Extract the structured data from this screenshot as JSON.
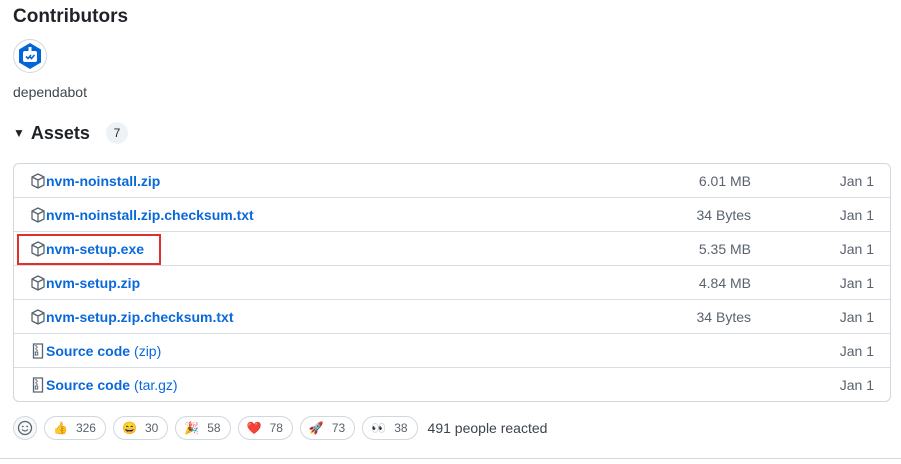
{
  "contributors": {
    "title": "Contributors",
    "names": [
      "dependabot"
    ]
  },
  "assets": {
    "title": "Assets",
    "count": "7",
    "items": [
      {
        "name": "nvm-noinstall.zip",
        "suffix": "",
        "size": "6.01 MB",
        "date": "Jan 1",
        "icon": "package-icon"
      },
      {
        "name": "nvm-noinstall.zip.checksum.txt",
        "suffix": "",
        "size": "34 Bytes",
        "date": "Jan 1",
        "icon": "package-icon"
      },
      {
        "name": "nvm-setup.exe",
        "suffix": "",
        "size": "5.35 MB",
        "date": "Jan 1",
        "icon": "package-icon"
      },
      {
        "name": "nvm-setup.zip",
        "suffix": "",
        "size": "4.84 MB",
        "date": "Jan 1",
        "icon": "package-icon"
      },
      {
        "name": "nvm-setup.zip.checksum.txt",
        "suffix": "",
        "size": "34 Bytes",
        "date": "Jan 1",
        "icon": "package-icon"
      },
      {
        "name": "Source code",
        "suffix": "(zip)",
        "size": "",
        "date": "Jan 1",
        "icon": "file-zip-icon"
      },
      {
        "name": "Source code",
        "suffix": "(tar.gz)",
        "size": "",
        "date": "Jan 1",
        "icon": "file-zip-icon"
      }
    ]
  },
  "reactions": {
    "items": [
      {
        "emoji": "👍",
        "count": "326",
        "icon": "thumbs-up-icon"
      },
      {
        "emoji": "😄",
        "count": "30",
        "icon": "laugh-icon"
      },
      {
        "emoji": "🎉",
        "count": "58",
        "icon": "hooray-icon"
      },
      {
        "emoji": "❤️",
        "count": "78",
        "icon": "heart-icon"
      },
      {
        "emoji": "🚀",
        "count": "73",
        "icon": "rocket-icon"
      },
      {
        "emoji": "👀",
        "count": "38",
        "icon": "eyes-icon"
      }
    ],
    "summary": "491 people reacted"
  },
  "colors": {
    "link": "#0969da",
    "highlight": "#e0302e",
    "avatar_brand": "#0366d6"
  }
}
